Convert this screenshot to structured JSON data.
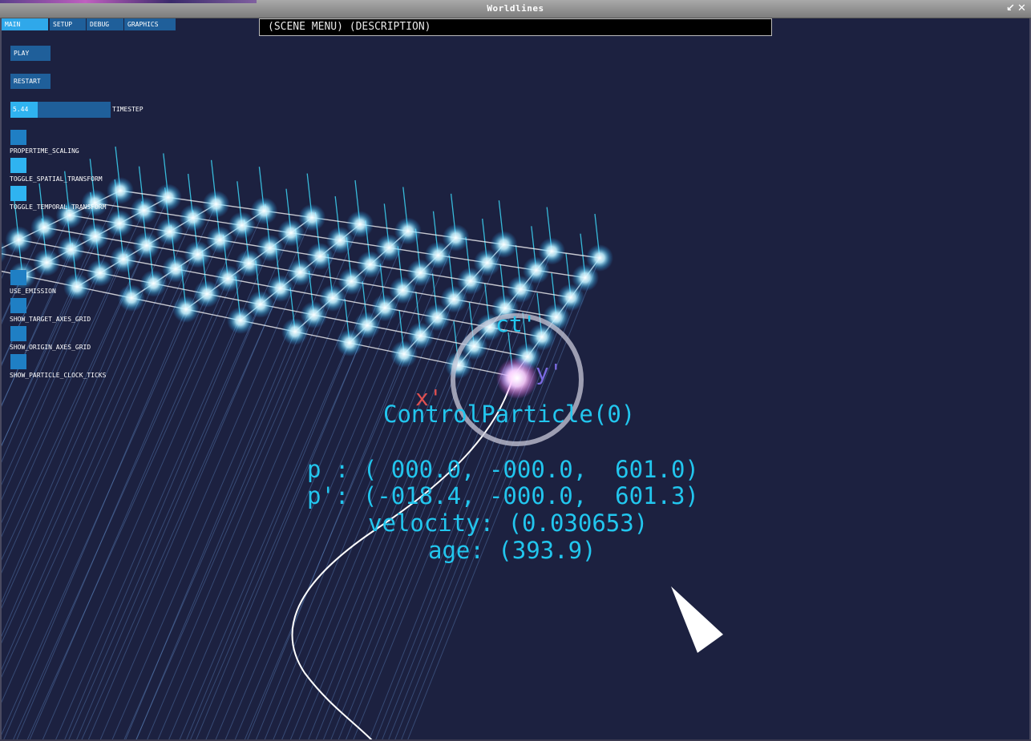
{
  "window": {
    "title": "Worldlines"
  },
  "tabs": [
    {
      "label": "MAIN"
    },
    {
      "label": "SETUP"
    },
    {
      "label": "DEBUG"
    },
    {
      "label": "GRAPHICS"
    }
  ],
  "controls": {
    "play_label": "PLAY",
    "restart_label": "RESTART",
    "timestep": {
      "value": "5.44",
      "label": "TIMESTEP",
      "fill_fraction": 0.27
    }
  },
  "toggles": [
    {
      "label": "PROPERTIME_SCALING",
      "checked": false
    },
    {
      "label": "TOGGLE_SPATIAL_TRANSFORM",
      "checked": true
    },
    {
      "label": "TOGGLE_TEMPORAL_TRANSFORM",
      "checked": true
    },
    {
      "label": "USE_EMISSION",
      "checked": false
    },
    {
      "label": "SHOW_TARGET_AXES_GRID",
      "checked": false
    },
    {
      "label": "SHOW_ORIGIN_AXES_GRID",
      "checked": false
    },
    {
      "label": "SHOW_PARTICLE_CLOCK_TICKS",
      "checked": false
    }
  ],
  "scene_menu": {
    "text": "(SCENE MENU) (DESCRIPTION)"
  },
  "particle": {
    "name": "ControlParticle(0)",
    "p": "p : ( 000.0, -000.0,  601.0)",
    "p_prime": "p': (-018.4, -000.0,  601.3)",
    "velocity": "velocity: (0.030653)",
    "age": "age: (393.9)"
  },
  "axes": {
    "x": "x'",
    "y": "y'",
    "ct": "ct'"
  },
  "colors": {
    "background": "#1c2140",
    "tab_active": "#2fa8ea",
    "tab_inactive": "#1f5f9a",
    "label_cyan": "#22c6ee",
    "axis_x": "#e05050",
    "axis_y": "#7a6adf",
    "axis_ct": "#22c6ee"
  }
}
